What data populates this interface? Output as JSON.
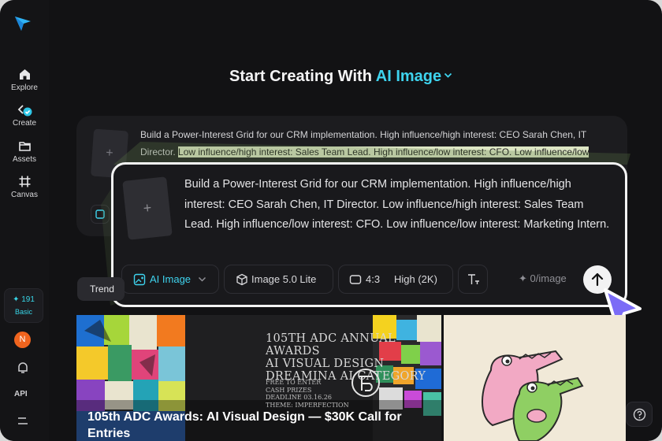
{
  "sidebar": {
    "items": [
      {
        "label": "Explore",
        "icon": "home-icon"
      },
      {
        "label": "Create",
        "icon": "create-icon"
      },
      {
        "label": "Assets",
        "icon": "folder-icon"
      },
      {
        "label": "Canvas",
        "icon": "canvas-icon"
      }
    ],
    "credits": "191",
    "plan": "Basic",
    "avatar_initial": "N",
    "api_label": "API"
  },
  "heading": {
    "prefix": "Start Creating With",
    "mode": "AI Image"
  },
  "background_prompt": {
    "text_before": "Build a Power-Interest Grid for our CRM implementation. High influence/high interest: CEO Sarah Chen, IT Director. ",
    "text_highlight": "Low influence/high interest: Sales Team Lead. High influence/low interest: CFO. Low influence/low",
    "thumb_symbol": "+"
  },
  "prompt": {
    "text": "Build a Power-Interest Grid for our CRM implementation. High influence/high interest: CEO Sarah Chen, IT Director. Low influence/high interest: Sales Team Lead. High influence/low interest: CFO. Low influence/low interest: Marketing Intern.",
    "thumb_symbol": "+"
  },
  "toolbar": {
    "mode_label": "AI Image",
    "model_label": "Image 5.0 Lite",
    "ratio_label": "4:3",
    "quality_label": "High (2K)",
    "cost_label": "0/image"
  },
  "tabs": {
    "trending_label": "Trend"
  },
  "gallery": {
    "card1": {
      "award_lines": [
        "105TH ADC ANNUAL AWARDS",
        "AI VISUAL DESIGN",
        "DREAMINA AI CATEGORY"
      ],
      "detail_lines": [
        "FREE TO ENTER",
        "CASH PRIZES",
        "DEADLINE 03.16.26",
        "THEME: IMPERFECTION"
      ],
      "title": "105th ADC Awards: AI Visual Design — $30K Call for Entries"
    }
  },
  "colors": {
    "accent": "#3ed3ee",
    "background": "#121214",
    "cursor": "#7b6cf6",
    "highlight": "#dde6c4"
  }
}
